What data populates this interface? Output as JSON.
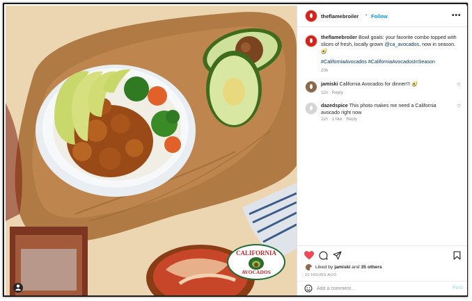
{
  "post": {
    "username": "theflamebroiler",
    "follow_label": "Follow",
    "separator": "•",
    "more_label": "•••"
  },
  "caption": {
    "username": "theflamebroiler",
    "text_1": "Bowl goals: your favorite combo topped with slices of fresh, locally grown ",
    "mention": "@ca_avocados",
    "text_2": ", now in season.",
    "emoji": "🥑",
    "hashtags": "#CaliforniaAvocados #CaliforniaAvocadosInSeason",
    "time": "20h"
  },
  "comments": [
    {
      "user": "jamiski",
      "text": "California Avocados for dinner!!! 🥑",
      "time": "11h",
      "reply": "Reply"
    },
    {
      "user": "dazedspice",
      "text": "This photo makes me need a California avocado right now",
      "time": "11h",
      "likes": "1 like",
      "reply": "Reply"
    }
  ],
  "likes": {
    "prefix": "Liked by ",
    "user": "jamiski",
    "middle": " and ",
    "others": "35 others"
  },
  "post_time": "20 HOURS AGO",
  "add_comment": {
    "placeholder": "Add a comment...",
    "post_label": "Post"
  },
  "photo_badge": {
    "line1": "CALIFORNIA",
    "line2": "AVOCADOS"
  },
  "colors": {
    "brand": "#d3241c",
    "link": "#0095f6",
    "like_red": "#ed4956"
  },
  "icons": [
    "heart-icon",
    "comment-icon",
    "share-icon",
    "bookmark-icon",
    "emoji-icon",
    "user-tag-icon"
  ]
}
